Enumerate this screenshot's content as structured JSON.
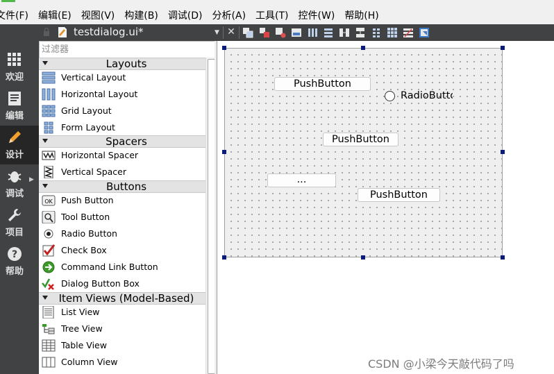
{
  "menu": [
    "文件(F)",
    "编辑(E)",
    "视图(V)",
    "构建(B)",
    "调试(D)",
    "分析(A)",
    "工具(T)",
    "控件(W)",
    "帮助(H)"
  ],
  "modes": [
    {
      "label": "欢迎",
      "icon": "grid-icon"
    },
    {
      "label": "编辑",
      "icon": "edit-doc-icon"
    },
    {
      "label": "设计",
      "icon": "pencil-icon"
    },
    {
      "label": "调试",
      "icon": "bug-icon"
    },
    {
      "label": "项目",
      "icon": "wrench-icon"
    },
    {
      "label": "帮助",
      "icon": "help-icon"
    }
  ],
  "editor": {
    "file_title": "testdialog.ui*"
  },
  "widgetbox": {
    "filter_placeholder": "过滤器",
    "categories": [
      {
        "name": "Layouts",
        "items": [
          "Vertical Layout",
          "Horizontal Layout",
          "Grid Layout",
          "Form Layout"
        ]
      },
      {
        "name": "Spacers",
        "items": [
          "Horizontal Spacer",
          "Vertical Spacer"
        ]
      },
      {
        "name": "Buttons",
        "items": [
          "Push Button",
          "Tool Button",
          "Radio Button",
          "Check Box",
          "Command Link Button",
          "Dialog Button Box"
        ]
      },
      {
        "name": "Item Views (Model-Based)",
        "items": [
          "List View",
          "Tree View",
          "Table View",
          "Column View"
        ]
      }
    ]
  },
  "form": {
    "buttons": [
      "PushButton",
      "PushButton",
      "...",
      "PushButton"
    ],
    "radio_label": "RadioButton",
    "handle_color": "#0b1b7a"
  },
  "watermark": "CSDN @小梁今天敲代码了吗"
}
